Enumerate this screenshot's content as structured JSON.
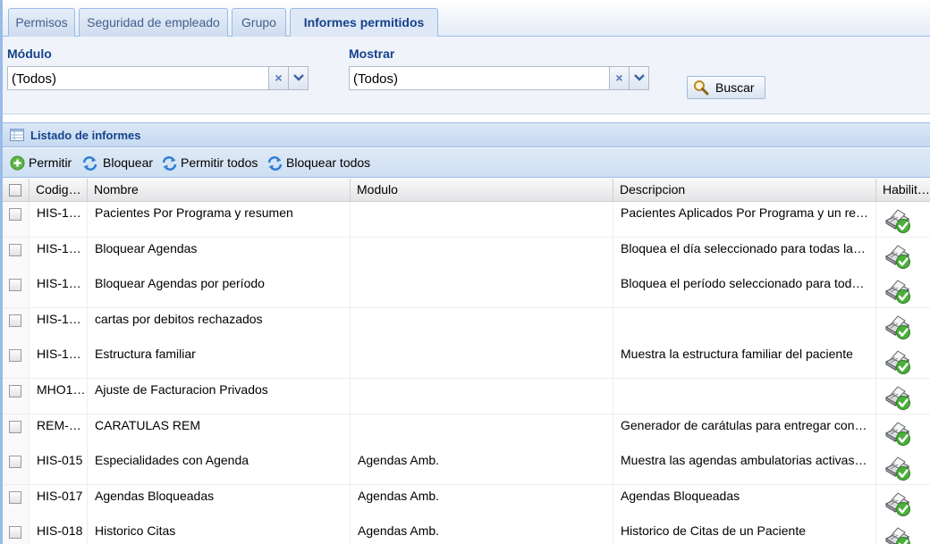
{
  "tabs": [
    {
      "label": "Permisos",
      "active": false
    },
    {
      "label": "Seguridad de empleado",
      "active": false
    },
    {
      "label": "Grupo",
      "active": false
    },
    {
      "label": "Informes permitidos",
      "active": true
    }
  ],
  "filters": {
    "modulo": {
      "label": "Módulo",
      "value": "(Todos)"
    },
    "mostrar": {
      "label": "Mostrar",
      "value": "(Todos)"
    },
    "search_button": "Buscar"
  },
  "grid": {
    "title": "Listado de informes",
    "toolbar": [
      "Permitir",
      "Bloquear",
      "Permitir todos",
      "Bloquear todos"
    ],
    "columns": [
      "Codig…",
      "Nombre",
      "Modulo",
      "Descripcion",
      "Habilit…"
    ],
    "rows": [
      {
        "codigo": "HIS-1…",
        "nombre": "Pacientes Por Programa y resumen",
        "modulo": "",
        "descripcion": "Pacientes Aplicados Por Programa y un res…"
      },
      {
        "codigo": "HIS-1…",
        "nombre": "Bloquear Agendas",
        "modulo": "",
        "descripcion": "Bloquea el día seleccionado para todas las …"
      },
      {
        "codigo": "HIS-1…",
        "nombre": "Bloquear Agendas por período",
        "modulo": "",
        "descripcion": "Bloquea el período seleccionado para toda…"
      },
      {
        "codigo": "HIS-1…",
        "nombre": "cartas por debitos rechazados",
        "modulo": "",
        "descripcion": ""
      },
      {
        "codigo": "HIS-1…",
        "nombre": "Estructura familiar",
        "modulo": "",
        "descripcion": "Muestra la estructura familiar del paciente"
      },
      {
        "codigo": "MHO1…",
        "nombre": "Ajuste de Facturacion Privados",
        "modulo": "",
        "descripcion": ""
      },
      {
        "codigo": "REM-…",
        "nombre": "CARATULAS REM",
        "modulo": "",
        "descripcion": "Generador de carátulas para entregar con l…"
      },
      {
        "codigo": "HIS-015",
        "nombre": "Especialidades con Agenda",
        "modulo": "Agendas Amb.",
        "descripcion": "Muestra las agendas ambulatorias activas/…"
      },
      {
        "codigo": "HIS-017",
        "nombre": "Agendas Bloqueadas",
        "modulo": "Agendas Amb.",
        "descripcion": "Agendas Bloqueadas"
      },
      {
        "codigo": "HIS-018",
        "nombre": "Historico Citas",
        "modulo": "Agendas Amb.",
        "descripcion": "Historico de Citas de un Paciente"
      }
    ]
  }
}
